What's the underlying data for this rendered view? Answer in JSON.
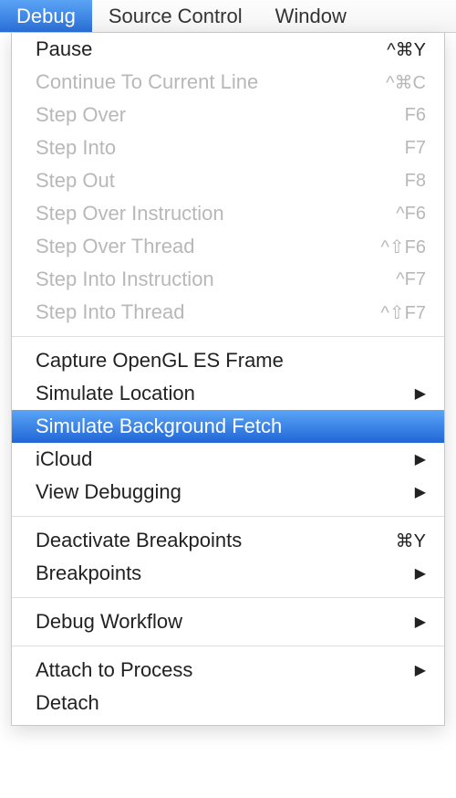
{
  "menubar": {
    "items": [
      {
        "label": "Debug",
        "active": true
      },
      {
        "label": "Source Control",
        "active": false
      },
      {
        "label": "Window",
        "active": false
      }
    ]
  },
  "dropdown": {
    "groups": [
      [
        {
          "label": "Pause",
          "shortcut": "^⌘Y",
          "enabled": true,
          "selected": false,
          "submenu": false
        },
        {
          "label": "Continue To Current Line",
          "shortcut": "^⌘C",
          "enabled": false,
          "selected": false,
          "submenu": false
        },
        {
          "label": "Step Over",
          "shortcut": "F6",
          "enabled": false,
          "selected": false,
          "submenu": false
        },
        {
          "label": "Step Into",
          "shortcut": "F7",
          "enabled": false,
          "selected": false,
          "submenu": false
        },
        {
          "label": "Step Out",
          "shortcut": "F8",
          "enabled": false,
          "selected": false,
          "submenu": false
        },
        {
          "label": "Step Over Instruction",
          "shortcut": "^F6",
          "enabled": false,
          "selected": false,
          "submenu": false
        },
        {
          "label": "Step Over Thread",
          "shortcut": "^⇧F6",
          "enabled": false,
          "selected": false,
          "submenu": false
        },
        {
          "label": "Step Into Instruction",
          "shortcut": "^F7",
          "enabled": false,
          "selected": false,
          "submenu": false
        },
        {
          "label": "Step Into Thread",
          "shortcut": "^⇧F7",
          "enabled": false,
          "selected": false,
          "submenu": false
        }
      ],
      [
        {
          "label": "Capture OpenGL ES Frame",
          "shortcut": "",
          "enabled": true,
          "selected": false,
          "submenu": false
        },
        {
          "label": "Simulate Location",
          "shortcut": "",
          "enabled": true,
          "selected": false,
          "submenu": true
        },
        {
          "label": "Simulate Background Fetch",
          "shortcut": "",
          "enabled": true,
          "selected": true,
          "submenu": false
        },
        {
          "label": "iCloud",
          "shortcut": "",
          "enabled": true,
          "selected": false,
          "submenu": true
        },
        {
          "label": "View Debugging",
          "shortcut": "",
          "enabled": true,
          "selected": false,
          "submenu": true
        }
      ],
      [
        {
          "label": "Deactivate Breakpoints",
          "shortcut": "⌘Y",
          "enabled": true,
          "selected": false,
          "submenu": false
        },
        {
          "label": "Breakpoints",
          "shortcut": "",
          "enabled": true,
          "selected": false,
          "submenu": true
        }
      ],
      [
        {
          "label": "Debug Workflow",
          "shortcut": "",
          "enabled": true,
          "selected": false,
          "submenu": true
        }
      ],
      [
        {
          "label": "Attach to Process",
          "shortcut": "",
          "enabled": true,
          "selected": false,
          "submenu": true
        },
        {
          "label": "Detach",
          "shortcut": "",
          "enabled": true,
          "selected": false,
          "submenu": false
        }
      ]
    ]
  }
}
